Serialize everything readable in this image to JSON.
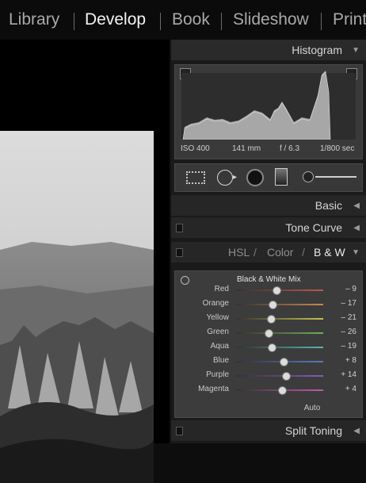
{
  "modules": [
    "Library",
    "Develop",
    "Book",
    "Slideshow",
    "Print"
  ],
  "active_module": "Develop",
  "histogram": {
    "title": "Histogram",
    "iso": "ISO 400",
    "focal": "141 mm",
    "aperture": "f / 6.3",
    "shutter": "1/800 sec"
  },
  "panels": {
    "basic": "Basic",
    "tone_curve": "Tone Curve",
    "split_toning": "Split Toning"
  },
  "hsl_tabs": {
    "hsl": "HSL",
    "sep1": "/",
    "color": "Color",
    "sep2": "/",
    "bw": "B & W"
  },
  "bw_mix": {
    "title": "Black & White Mix",
    "sliders": [
      {
        "label": "Red",
        "value": "– 9",
        "level": -9,
        "color": "#c0564e"
      },
      {
        "label": "Orange",
        "value": "– 17",
        "level": -17,
        "color": "#c88a4a"
      },
      {
        "label": "Yellow",
        "value": "– 21",
        "level": -21,
        "color": "#c8c24a"
      },
      {
        "label": "Green",
        "value": "– 26",
        "level": -26,
        "color": "#6fb05a"
      },
      {
        "label": "Aqua",
        "value": "– 19",
        "level": -19,
        "color": "#57b7b0"
      },
      {
        "label": "Blue",
        "value": "+ 8",
        "level": 8,
        "color": "#5a78c8"
      },
      {
        "label": "Purple",
        "value": "+ 14",
        "level": 14,
        "color": "#8a5ac0"
      },
      {
        "label": "Magenta",
        "value": "+ 4",
        "level": 4,
        "color": "#c05aa8"
      }
    ],
    "auto": "Auto"
  }
}
